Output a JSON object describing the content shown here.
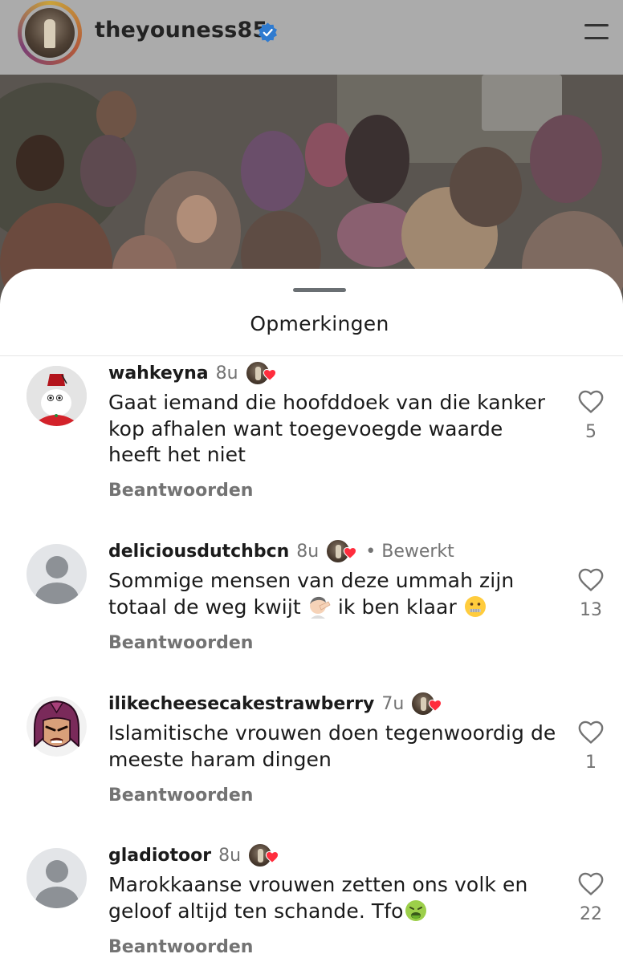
{
  "header": {
    "username": "theyouness85",
    "verified_icon": "verified-badge-icon",
    "menu_icon": "hamburger-menu-icon"
  },
  "sheet": {
    "title": "Opmerkingen"
  },
  "comments": [
    {
      "username": "wahkeyna",
      "time": "8u",
      "edited": "",
      "text": "Gaat iemand die hoofddoek van die kanker kop afhalen want toegevoegde waarde heeft het niet",
      "reply_label": "Beantwoorden",
      "likes": "5",
      "avatar": "fez-character-avatar"
    },
    {
      "username": "deliciousdutchbcn",
      "time": "8u",
      "edited": "• Bewerkt",
      "text_before_emoji": "Sommige mensen van deze ummah zijn totaal de weg kwijt ",
      "emoji_1": "man-facepalming-emoji",
      "text_middle": " ik ben klaar ",
      "emoji_2": "zipper-mouth-face-emoji",
      "reply_label": "Beantwoorden",
      "likes": "13",
      "avatar": "default-avatar"
    },
    {
      "username": "ilikecheesecakestrawberry",
      "time": "7u",
      "edited": "",
      "text": "Islamitische vrouwen doen tegenwoordig de meeste haram dingen",
      "reply_label": "Beantwoorden",
      "likes": "1",
      "avatar": "helmeted-villain-avatar"
    },
    {
      "username": "gladiotoor",
      "time": "8u",
      "edited": "",
      "text_before_emoji": "Marokkaanse vrouwen zetten ons volk en geloof altijd ten schande. Tfo",
      "emoji_1": "nauseated-face-emoji",
      "reply_label": "Beantwoorden",
      "likes": "22",
      "avatar": "default-avatar"
    }
  ],
  "colors": {
    "secondary_text": "#737373",
    "heart_red": "#ff3040",
    "verified_blue": "#3797f0"
  }
}
